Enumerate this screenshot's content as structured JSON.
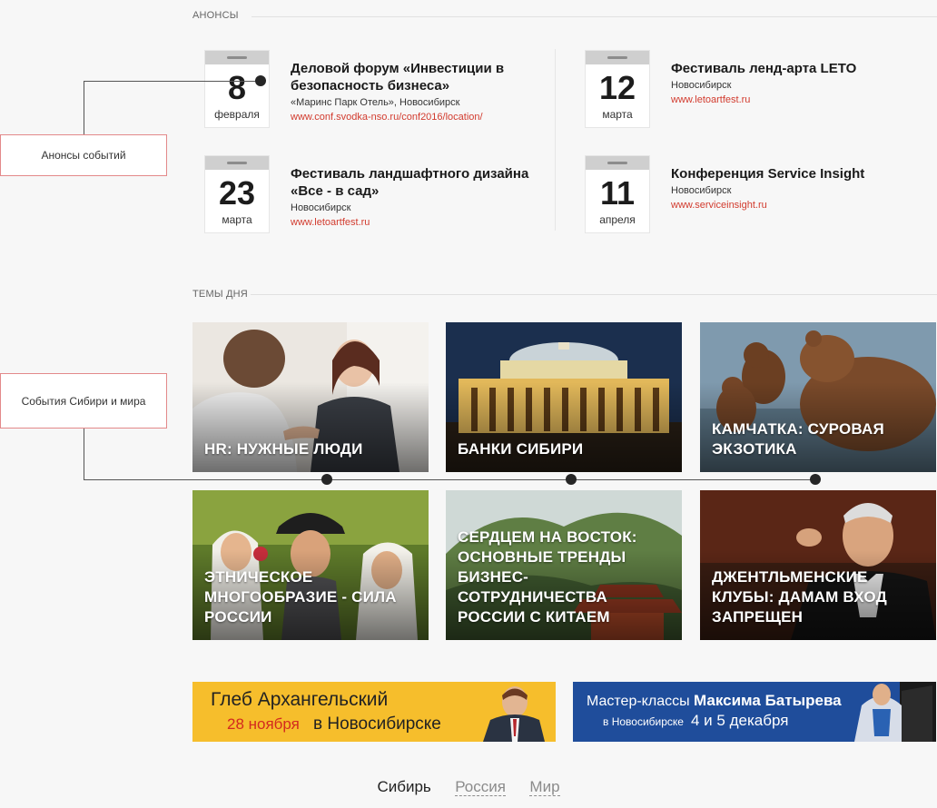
{
  "sections": {
    "announcements": "АНОНСЫ",
    "topics": "ТЕМЫ ДНЯ"
  },
  "callouts": {
    "events": "Анонсы событий",
    "topics": "События Сибири и мира"
  },
  "events": [
    {
      "day": "8",
      "month": "февраля",
      "title": "Деловой форум «Инвестиции в безопасность бизнеса»",
      "place": "«Маринс Парк Отель», Новосибирск",
      "link": "www.conf.svodka-nso.ru/conf2016/location/"
    },
    {
      "day": "12",
      "month": "марта",
      "title": "Фестиваль ленд-арта LETO",
      "place": "Новосибирск",
      "link": "www.letoartfest.ru"
    },
    {
      "day": "23",
      "month": "марта",
      "title": "Фестиваль ландшафтного дизайна «Все - в сад»",
      "place": "Новосибирск",
      "link": "www.letoartfest.ru"
    },
    {
      "day": "11",
      "month": "апреля",
      "title": "Конференция Service Insight",
      "place": "Новосибирск",
      "link": "www.serviceinsight.ru"
    }
  ],
  "topics": [
    {
      "title": "HR: нужные люди"
    },
    {
      "title": "Банки Сибири"
    },
    {
      "title": "Камчатка: суровая экзотика"
    },
    {
      "title": "Этническое многообразие - сила России"
    },
    {
      "title": "Сердцем на восток: основные тренды бизнес-сотрудничества России с Китаем"
    },
    {
      "title": "Джентльменские клубы: дамам вход запрещен"
    }
  ],
  "banners": {
    "left": {
      "name": "Глеб Архангельский",
      "date": "28 ноября",
      "city": "в Новосибирске"
    },
    "right": {
      "lead": "Мастер-классы",
      "name": "Максима Батырева",
      "city": "в Новосибирске",
      "date": "4 и 5 декабря"
    }
  },
  "tabs": [
    "Сибирь",
    "Россия",
    "Мир"
  ],
  "colors": {
    "accent": "#d23b2e",
    "callout_border": "#e3898a",
    "banner_yellow": "#f6be2c",
    "banner_blue": "#1f4d9b"
  }
}
